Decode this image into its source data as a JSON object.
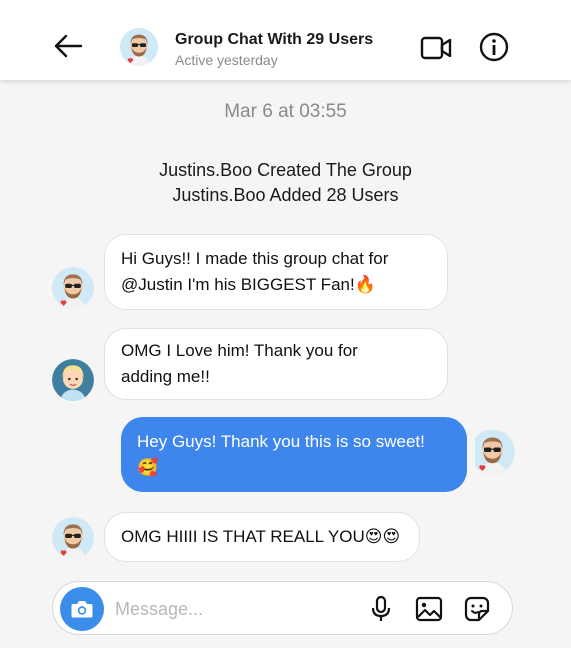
{
  "header": {
    "title": "Group Chat With 29 Users",
    "status": "Active yesterday",
    "icons": [
      "back-arrow-icon",
      "video-call-icon",
      "info-icon"
    ]
  },
  "chat": {
    "timestamp": "Mar 6 at 03:55",
    "system_messages": [
      "Justins.Boo Created The Group",
      "Justins.Boo Added 28 Users"
    ],
    "messages": [
      {
        "direction": "incoming",
        "lines": [
          "Hi Guys!! I made this group chat for",
          "@Justin I'm his BIGGEST Fan!🔥"
        ]
      },
      {
        "direction": "incoming",
        "lines": [
          "OMG I Love him! Thank you for",
          "adding me!!"
        ]
      },
      {
        "direction": "outgoing",
        "lines": [
          "Hey Guys! Thank you this is so sweet!",
          "🥰"
        ]
      },
      {
        "direction": "incoming",
        "lines": [
          "OMG HIIII IS THAT REALL YOU😍😍"
        ]
      }
    ]
  },
  "composer": {
    "placeholder": "Message...",
    "icons": [
      "camera-icon",
      "microphone-icon",
      "gallery-icon",
      "sticker-icon"
    ]
  },
  "colors": {
    "outgoing_bubble": "#3f86ec",
    "camera_button": "#3a8eea",
    "background": "#f5f5f5"
  }
}
